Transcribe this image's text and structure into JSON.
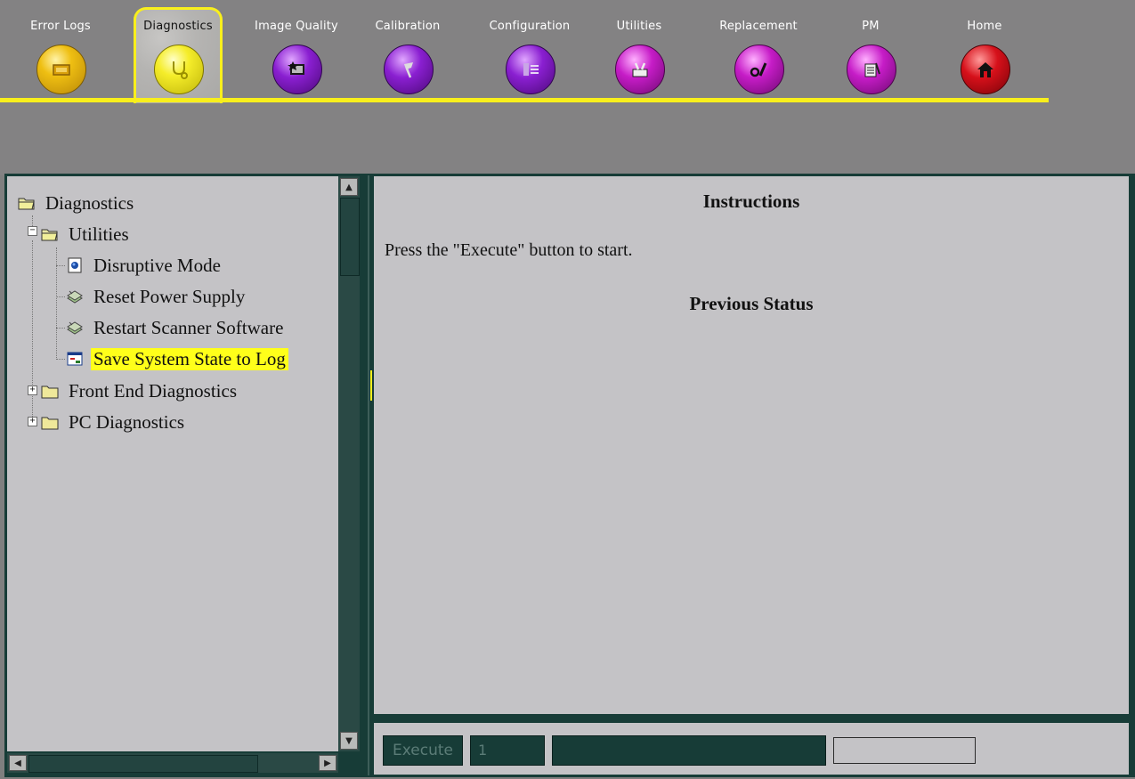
{
  "tabs": [
    {
      "label": "Error Logs",
      "icon": "error-log-icon",
      "color": "#e7b30b"
    },
    {
      "label": "Diagnostics",
      "icon": "stethoscope-icon",
      "color": "#f3ea22",
      "active": true
    },
    {
      "label": "Image Quality",
      "icon": "image-quality-icon",
      "color": "#8a1fd1"
    },
    {
      "label": "Calibration",
      "icon": "calibration-icon",
      "color": "#8a1fd1"
    },
    {
      "label": "Configuration",
      "icon": "configuration-icon",
      "color": "#8a1fd1"
    },
    {
      "label": "Utilities",
      "icon": "utilities-icon",
      "color": "#c61cc7"
    },
    {
      "label": "Replacement",
      "icon": "replacement-icon",
      "color": "#c61cc7"
    },
    {
      "label": "PM",
      "icon": "pm-icon",
      "color": "#c61cc7"
    },
    {
      "label": "Home",
      "icon": "home-icon",
      "color": "#d6101a"
    }
  ],
  "tree": {
    "root": "Diagnostics",
    "utilities": "Utilities",
    "children": [
      {
        "label": "Disruptive Mode",
        "icon": "disruptive-mode-icon"
      },
      {
        "label": "Reset Power Supply",
        "icon": "reset-icon"
      },
      {
        "label": "Restart Scanner Software",
        "icon": "restart-icon"
      },
      {
        "label": "Save System State to Log",
        "icon": "save-log-icon",
        "selected": true
      }
    ],
    "front_end": "Front End Diagnostics",
    "pc": "PC Diagnostics"
  },
  "content": {
    "instructions_heading": "Instructions",
    "instructions_text": "Press the \"Execute\" button to start.",
    "status_heading": "Previous Status"
  },
  "bottom": {
    "execute_label": "Execute",
    "field_value": "1"
  },
  "colors": {
    "accent_yellow": "#f8ef1c",
    "panel_bg": "#c4c3c6",
    "frame_dark": "#173c37"
  }
}
